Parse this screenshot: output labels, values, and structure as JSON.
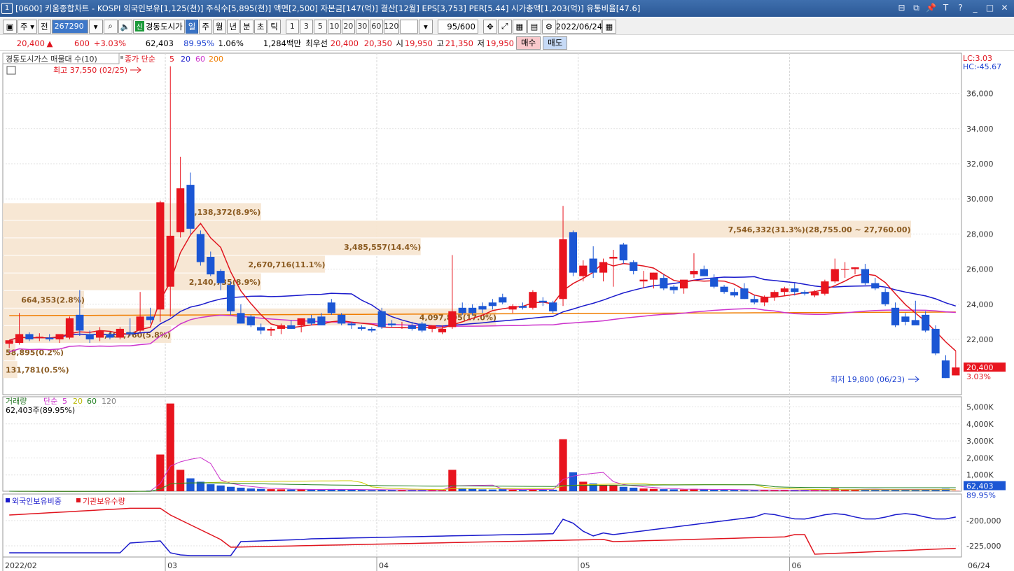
{
  "window": {
    "number": "1",
    "title": "[0600] 키움종합차트 - KOSPI 외국인보유[1,125(천)] 주식수[5,895(천)] 액면[2,500] 자본금[147(억)] 결산[12월] EPS[3,753] PER[5.44] 시가총액[1,203(억)] 유통비율[47.6]",
    "buttons": [
      "⊟",
      "⧉",
      "📌",
      "T",
      "?",
      "_",
      "□",
      "✕"
    ]
  },
  "toolbar": {
    "period_type": "주",
    "prev": "전",
    "code": "267290",
    "stock_name": "경동도시가",
    "stock_badge": "신",
    "intervals": [
      "일",
      "주",
      "월",
      "년",
      "분",
      "초",
      "틱"
    ],
    "selected_interval": "일",
    "periods": [
      "1",
      "3",
      "5",
      "10",
      "20",
      "30",
      "60",
      "120"
    ],
    "count": "95",
    "count_total": "/600",
    "date": "2022/06/24"
  },
  "quote": {
    "price": "20,400",
    "arrow": "▲",
    "change": "600",
    "change_pct": "+3.03%",
    "volume": "62,403",
    "volume_ratio": "89.95%",
    "turnover": "1.06%",
    "amount": "1,284백만",
    "priority_label": "최우선",
    "ask": "20,400",
    "bid": "20,350",
    "open_label": "시",
    "open": "19,950",
    "high_label": "고",
    "high": "21,350",
    "low_label": "저",
    "low": "19,950",
    "buy_label": "매수",
    "sell_label": "매도"
  },
  "price_panel": {
    "tag": "경동도시가스 매물대 수(10)",
    "legend_label": "종가 단순",
    "ma_periods": [
      "5",
      "20",
      "60",
      "200"
    ],
    "ma_colors": [
      "#e0141e",
      "#1a1acc",
      "#cc33cc",
      "#f07d00"
    ],
    "lc_label": "LC:3.03",
    "hc_label": "HC:-45.67",
    "high_note": "최고 37,550 (02/25)",
    "low_note": "최저 19,800 (06/23)",
    "current_price": "20,400",
    "current_pct": "3.03%",
    "y_ticks": [
      "36,000",
      "34,000",
      "32,000",
      "30,000",
      "28,000",
      "26,000",
      "24,000",
      "22,000"
    ],
    "volume_profile": [
      {
        "label": "7,546,332(31.3%)(28,755.00 ~ 27,760.00)",
        "value_pct": 31.3
      },
      {
        "label": "3,485,557(14.4%)",
        "value_pct": 14.4
      },
      {
        "label": "2,670,716(11.1%)",
        "value_pct": 11.1
      },
      {
        "label": "2,138,372(8.9%)",
        "value_pct": 8.9
      },
      {
        "label": "2,140,735(8.9%)",
        "value_pct": 8.9
      },
      {
        "label": "4,097,895(17.0%)",
        "value_pct": 17.0
      },
      {
        "label": "664,353(2.8%)",
        "value_pct": 2.8
      },
      {
        "label": "1,400,760(5.8%)",
        "value_pct": 5.8
      },
      {
        "label": "58,895(0.2%)",
        "value_pct": 0.2
      },
      {
        "label": "131,781(0.5%)",
        "value_pct": 0.5
      }
    ]
  },
  "volume_panel": {
    "legend_label": "거래량",
    "legend_ma": "단순",
    "ma_periods": [
      "5",
      "20",
      "60",
      "120"
    ],
    "ma_colors": [
      "#cc33cc",
      "#cccc00",
      "#208020",
      "#808080"
    ],
    "current": "62,403주(89.95%)",
    "current_value": "62,403",
    "current_pct": "89.95%",
    "y_ticks": [
      "5,000K",
      "4,000K",
      "3,000K",
      "2,000K",
      "1,000K"
    ]
  },
  "foreign_panel": {
    "legend_foreign": "외국인보유비중",
    "legend_inst": "기관보유수량",
    "y_ticks": [
      "-200,000",
      "-225,000"
    ]
  },
  "x_axis": [
    "2022/02",
    "03",
    "04",
    "05",
    "06",
    "06/24"
  ],
  "chart_data": {
    "type": "candlestick",
    "dates_span": [
      "2022/02",
      "2022/06/24"
    ],
    "ylim": [
      19800,
      37550
    ],
    "candles": [
      {
        "o": 21750,
        "h": 21900,
        "l": 21500,
        "c": 21950
      },
      {
        "o": 21800,
        "h": 23500,
        "l": 21700,
        "c": 22300
      },
      {
        "o": 22300,
        "h": 22400,
        "l": 21900,
        "c": 22000
      },
      {
        "o": 22100,
        "h": 22350,
        "l": 21900,
        "c": 22150
      },
      {
        "o": 22100,
        "h": 22300,
        "l": 21900,
        "c": 22000
      },
      {
        "o": 22000,
        "h": 22200,
        "l": 21800,
        "c": 22300
      },
      {
        "o": 22100,
        "h": 23300,
        "l": 22000,
        "c": 23200
      },
      {
        "o": 23400,
        "h": 24800,
        "l": 22200,
        "c": 22500
      },
      {
        "o": 22300,
        "h": 22500,
        "l": 21800,
        "c": 22000
      },
      {
        "o": 22100,
        "h": 22700,
        "l": 21900,
        "c": 22500
      },
      {
        "o": 22300,
        "h": 22400,
        "l": 22000,
        "c": 22100
      },
      {
        "o": 22100,
        "h": 22700,
        "l": 22000,
        "c": 22600
      },
      {
        "o": 22400,
        "h": 23200,
        "l": 22200,
        "c": 22300
      },
      {
        "o": 22500,
        "h": 24700,
        "l": 22400,
        "c": 23300
      },
      {
        "o": 23300,
        "h": 23800,
        "l": 22900,
        "c": 23100
      },
      {
        "o": 23700,
        "h": 29900,
        "l": 23000,
        "c": 29800
      },
      {
        "o": 25000,
        "h": 37550,
        "l": 23300,
        "c": 27900
      },
      {
        "o": 28100,
        "h": 32400,
        "l": 27800,
        "c": 30600
      },
      {
        "o": 30800,
        "h": 31500,
        "l": 28000,
        "c": 28300
      },
      {
        "o": 28000,
        "h": 28200,
        "l": 26200,
        "c": 26400
      },
      {
        "o": 26700,
        "h": 27000,
        "l": 25600,
        "c": 25700
      },
      {
        "o": 25900,
        "h": 26000,
        "l": 24800,
        "c": 25200
      },
      {
        "o": 25100,
        "h": 25300,
        "l": 23400,
        "c": 23600
      },
      {
        "o": 23500,
        "h": 24000,
        "l": 22900,
        "c": 22900
      },
      {
        "o": 23300,
        "h": 23400,
        "l": 22700,
        "c": 22800
      },
      {
        "o": 22700,
        "h": 22900,
        "l": 22300,
        "c": 22500
      },
      {
        "o": 22500,
        "h": 22700,
        "l": 22200,
        "c": 22600
      },
      {
        "o": 22600,
        "h": 22900,
        "l": 22300,
        "c": 22800
      },
      {
        "o": 22800,
        "h": 23100,
        "l": 22600,
        "c": 22600
      },
      {
        "o": 22800,
        "h": 23000,
        "l": 22400,
        "c": 23200
      },
      {
        "o": 23200,
        "h": 23400,
        "l": 22800,
        "c": 22900
      },
      {
        "o": 23300,
        "h": 23500,
        "l": 22800,
        "c": 22800
      },
      {
        "o": 24100,
        "h": 24300,
        "l": 23400,
        "c": 23500
      },
      {
        "o": 23400,
        "h": 23500,
        "l": 22800,
        "c": 22900
      },
      {
        "o": 22900,
        "h": 23000,
        "l": 22600,
        "c": 22800
      },
      {
        "o": 22700,
        "h": 22800,
        "l": 22500,
        "c": 22600
      },
      {
        "o": 22600,
        "h": 22700,
        "l": 22400,
        "c": 22500
      },
      {
        "o": 23600,
        "h": 23800,
        "l": 22600,
        "c": 22700
      },
      {
        "o": 22900,
        "h": 23100,
        "l": 22700,
        "c": 22800
      },
      {
        "o": 22700,
        "h": 23000,
        "l": 22600,
        "c": 22700
      },
      {
        "o": 22800,
        "h": 23000,
        "l": 22500,
        "c": 22600
      },
      {
        "o": 22900,
        "h": 23000,
        "l": 22400,
        "c": 22500
      },
      {
        "o": 22600,
        "h": 22800,
        "l": 22400,
        "c": 22800
      },
      {
        "o": 22400,
        "h": 22800,
        "l": 22300,
        "c": 22600
      },
      {
        "o": 22700,
        "h": 26800,
        "l": 22600,
        "c": 23600
      },
      {
        "o": 23800,
        "h": 24100,
        "l": 23400,
        "c": 23500
      },
      {
        "o": 23800,
        "h": 24000,
        "l": 23400,
        "c": 23500
      },
      {
        "o": 23900,
        "h": 24100,
        "l": 23500,
        "c": 23700
      },
      {
        "o": 24100,
        "h": 24300,
        "l": 23700,
        "c": 23900
      },
      {
        "o": 24400,
        "h": 24600,
        "l": 24000,
        "c": 24100
      },
      {
        "o": 23700,
        "h": 24000,
        "l": 23500,
        "c": 23900
      },
      {
        "o": 23900,
        "h": 24100,
        "l": 23700,
        "c": 23800
      },
      {
        "o": 23800,
        "h": 24800,
        "l": 23700,
        "c": 24700
      },
      {
        "o": 24200,
        "h": 24400,
        "l": 23900,
        "c": 24100
      },
      {
        "o": 24100,
        "h": 24200,
        "l": 23500,
        "c": 23600
      },
      {
        "o": 24300,
        "h": 29600,
        "l": 23900,
        "c": 27700
      },
      {
        "o": 28100,
        "h": 28200,
        "l": 25600,
        "c": 25800
      },
      {
        "o": 25600,
        "h": 26500,
        "l": 25300,
        "c": 26200
      },
      {
        "o": 26600,
        "h": 27300,
        "l": 25500,
        "c": 25800
      },
      {
        "o": 25800,
        "h": 26600,
        "l": 25300,
        "c": 26400
      },
      {
        "o": 26600,
        "h": 27100,
        "l": 25000,
        "c": 26700
      },
      {
        "o": 27400,
        "h": 27500,
        "l": 26300,
        "c": 26500
      },
      {
        "o": 26400,
        "h": 26500,
        "l": 25700,
        "c": 25900
      },
      {
        "o": 25300,
        "h": 25900,
        "l": 24900,
        "c": 25400
      },
      {
        "o": 25400,
        "h": 25800,
        "l": 24900,
        "c": 25800
      },
      {
        "o": 25500,
        "h": 25700,
        "l": 24800,
        "c": 24900
      },
      {
        "o": 25000,
        "h": 25100,
        "l": 24600,
        "c": 24800
      },
      {
        "o": 24900,
        "h": 25100,
        "l": 24600,
        "c": 25400
      },
      {
        "o": 25700,
        "h": 26900,
        "l": 25500,
        "c": 25900
      },
      {
        "o": 26000,
        "h": 26200,
        "l": 25600,
        "c": 25600
      },
      {
        "o": 25500,
        "h": 25700,
        "l": 24900,
        "c": 25000
      },
      {
        "o": 25000,
        "h": 25100,
        "l": 24600,
        "c": 24700
      },
      {
        "o": 24700,
        "h": 24900,
        "l": 24400,
        "c": 24500
      },
      {
        "o": 24900,
        "h": 25200,
        "l": 24300,
        "c": 24300
      },
      {
        "o": 24300,
        "h": 24500,
        "l": 24000,
        "c": 24100
      },
      {
        "o": 24100,
        "h": 24500,
        "l": 23900,
        "c": 24400
      },
      {
        "o": 24400,
        "h": 24800,
        "l": 24200,
        "c": 24700
      },
      {
        "o": 24700,
        "h": 25000,
        "l": 24500,
        "c": 24900
      },
      {
        "o": 24900,
        "h": 25200,
        "l": 24500,
        "c": 24700
      },
      {
        "o": 24700,
        "h": 24800,
        "l": 24500,
        "c": 24600
      },
      {
        "o": 24500,
        "h": 24800,
        "l": 24400,
        "c": 24700
      },
      {
        "o": 24600,
        "h": 25400,
        "l": 24500,
        "c": 25300
      },
      {
        "o": 25300,
        "h": 26600,
        "l": 25200,
        "c": 26000
      },
      {
        "o": 26000,
        "h": 26400,
        "l": 25500,
        "c": 26000
      },
      {
        "o": 26000,
        "h": 26100,
        "l": 25700,
        "c": 26100
      },
      {
        "o": 26000,
        "h": 26300,
        "l": 25100,
        "c": 25200
      },
      {
        "o": 25200,
        "h": 25500,
        "l": 24800,
        "c": 24900
      },
      {
        "o": 24700,
        "h": 24900,
        "l": 23900,
        "c": 24000
      },
      {
        "o": 23800,
        "h": 24100,
        "l": 22700,
        "c": 22800
      },
      {
        "o": 23300,
        "h": 23500,
        "l": 22800,
        "c": 23000
      },
      {
        "o": 23100,
        "h": 24200,
        "l": 22900,
        "c": 22800
      },
      {
        "o": 23400,
        "h": 23600,
        "l": 22400,
        "c": 22500
      },
      {
        "o": 22600,
        "h": 22800,
        "l": 21100,
        "c": 21200
      },
      {
        "o": 20800,
        "h": 21100,
        "l": 19800,
        "c": 19800
      },
      {
        "o": 19950,
        "h": 21350,
        "l": 19950,
        "c": 20400
      }
    ],
    "volume_thousands": [
      40,
      35,
      30,
      32,
      30,
      28,
      30,
      40,
      32,
      36,
      35,
      40,
      38,
      60,
      80,
      2200,
      5200,
      1300,
      800,
      600,
      450,
      380,
      300,
      250,
      200,
      180,
      160,
      150,
      140,
      150,
      140,
      130,
      170,
      150,
      130,
      120,
      110,
      140,
      120,
      110,
      100,
      100,
      100,
      110,
      1300,
      220,
      180,
      150,
      140,
      160,
      130,
      120,
      160,
      140,
      130,
      3100,
      1150,
      600,
      500,
      400,
      380,
      300,
      250,
      200,
      180,
      160,
      150,
      140,
      180,
      150,
      130,
      120,
      120,
      110,
      100,
      110,
      100,
      110,
      100,
      90,
      90,
      120,
      200,
      150,
      140,
      130,
      140,
      150,
      160,
      130,
      140,
      130,
      150,
      180,
      62
    ]
  }
}
